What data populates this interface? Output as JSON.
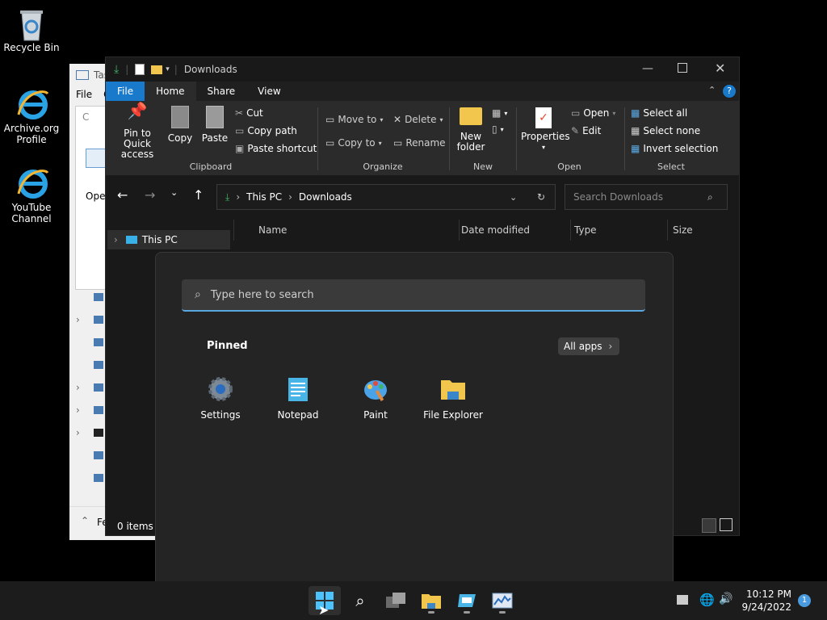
{
  "desktop": {
    "icons": [
      {
        "label": "Recycle Bin",
        "icon": "recycle-bin-icon"
      },
      {
        "label": "Archive.org Profile",
        "icon": "internet-explorer-icon"
      },
      {
        "label": "YouTube Channel",
        "icon": "internet-explorer-icon"
      }
    ]
  },
  "taskmgr": {
    "title": "Tas",
    "menu": [
      "File",
      "O"
    ],
    "partial_tab": "C",
    "partial_text": "Ope",
    "footer": "Fe"
  },
  "explorer": {
    "title": "Downloads",
    "tabs": [
      "File",
      "Home",
      "Share",
      "View"
    ],
    "clipboard": {
      "pin": "Pin to Quick access",
      "copy": "Copy",
      "paste": "Paste",
      "cut": "Cut",
      "copy_path": "Copy path",
      "paste_shortcut": "Paste shortcut",
      "label": "Clipboard"
    },
    "organize": {
      "move_to": "Move to",
      "copy_to": "Copy to",
      "delete": "Delete",
      "rename": "Rename",
      "label": "Organize"
    },
    "new": {
      "new_folder": "New folder",
      "label": "New"
    },
    "open": {
      "properties": "Properties",
      "open": "Open",
      "edit": "Edit",
      "label": "Open"
    },
    "select": {
      "select_all": "Select all",
      "select_none": "Select none",
      "invert": "Invert selection",
      "label": "Select"
    },
    "address": {
      "root": "This PC",
      "current": "Downloads"
    },
    "search_placeholder": "Search Downloads",
    "columns": [
      "Name",
      "Date modified",
      "Type",
      "Size"
    ],
    "tree": {
      "this_pc": "This PC"
    },
    "status": "0 items"
  },
  "start_menu": {
    "search_placeholder": "Type here to search",
    "pinned_label": "Pinned",
    "all_apps": "All apps",
    "apps": [
      {
        "label": "Settings",
        "icon": "settings-gear-icon"
      },
      {
        "label": "Notepad",
        "icon": "notepad-icon"
      },
      {
        "label": "Paint",
        "icon": "paint-palette-icon"
      },
      {
        "label": "File Explorer",
        "icon": "folder-icon"
      }
    ]
  },
  "taskbar": {
    "time": "10:12 PM",
    "date": "9/24/2022",
    "notification_count": "1"
  }
}
